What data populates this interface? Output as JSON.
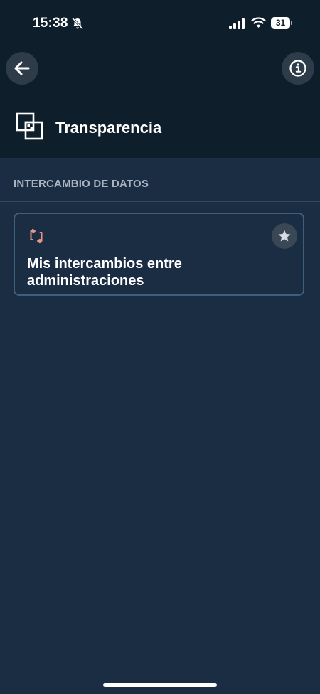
{
  "status_bar": {
    "time": "15:38",
    "battery": "31"
  },
  "header": {
    "title": "Transparencia"
  },
  "section": {
    "title": "INTERCAMBIO DE DATOS"
  },
  "cards": [
    {
      "title": "Mis intercambios entre administraciones"
    }
  ],
  "colors": {
    "background": "#1a2d42",
    "header_background": "#0f1e2b",
    "card_border": "#3e5f7b",
    "exchange_icon": "#e8968b",
    "section_text": "#aab4bf"
  },
  "icons": {
    "back": "arrow-left-icon",
    "info": "info-icon",
    "title": "transparency-squares-icon",
    "card": "exchange-arrows-icon",
    "favorite": "star-icon",
    "notification": "bell-muted-icon"
  }
}
